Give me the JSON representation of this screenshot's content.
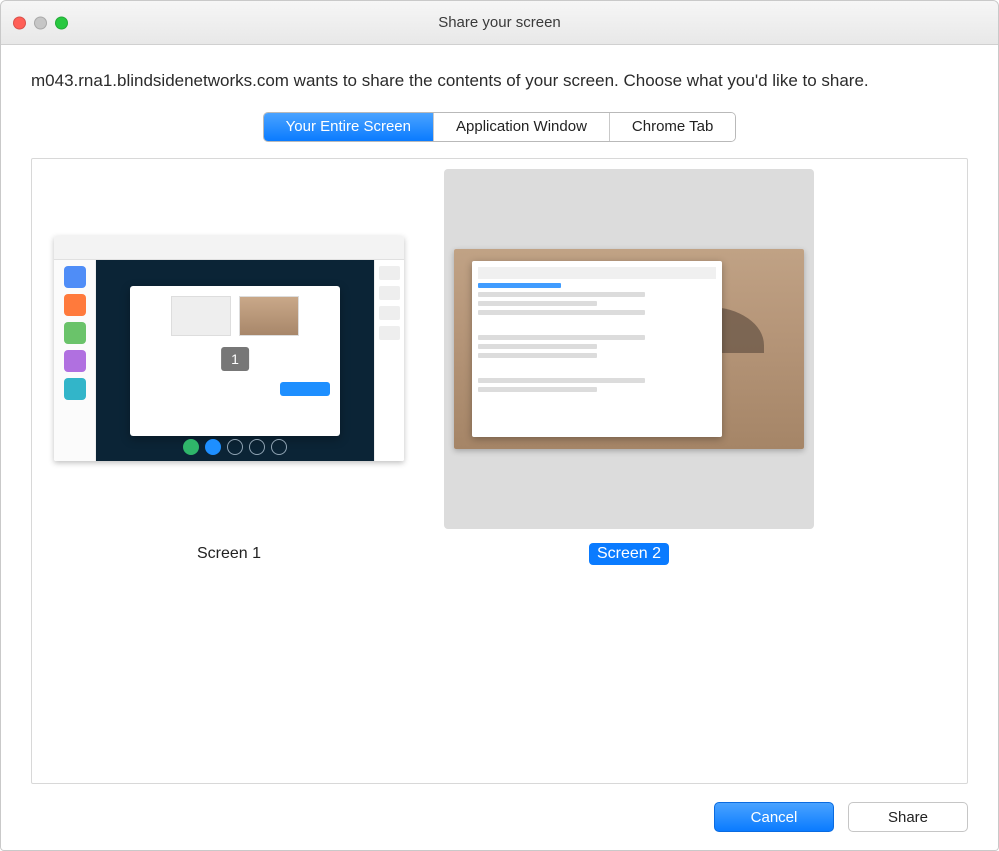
{
  "window": {
    "title": "Share your screen"
  },
  "prompt": "m043.rna1.blindsidenetworks.com wants to share the contents of your screen. Choose what you'd like to share.",
  "tabs": {
    "entire": "Your Entire Screen",
    "window": "Application Window",
    "tab": "Chrome Tab"
  },
  "screens": {
    "s1_label": "Screen 1",
    "s2_label": "Screen 2",
    "badge": "1"
  },
  "buttons": {
    "cancel": "Cancel",
    "share": "Share"
  }
}
